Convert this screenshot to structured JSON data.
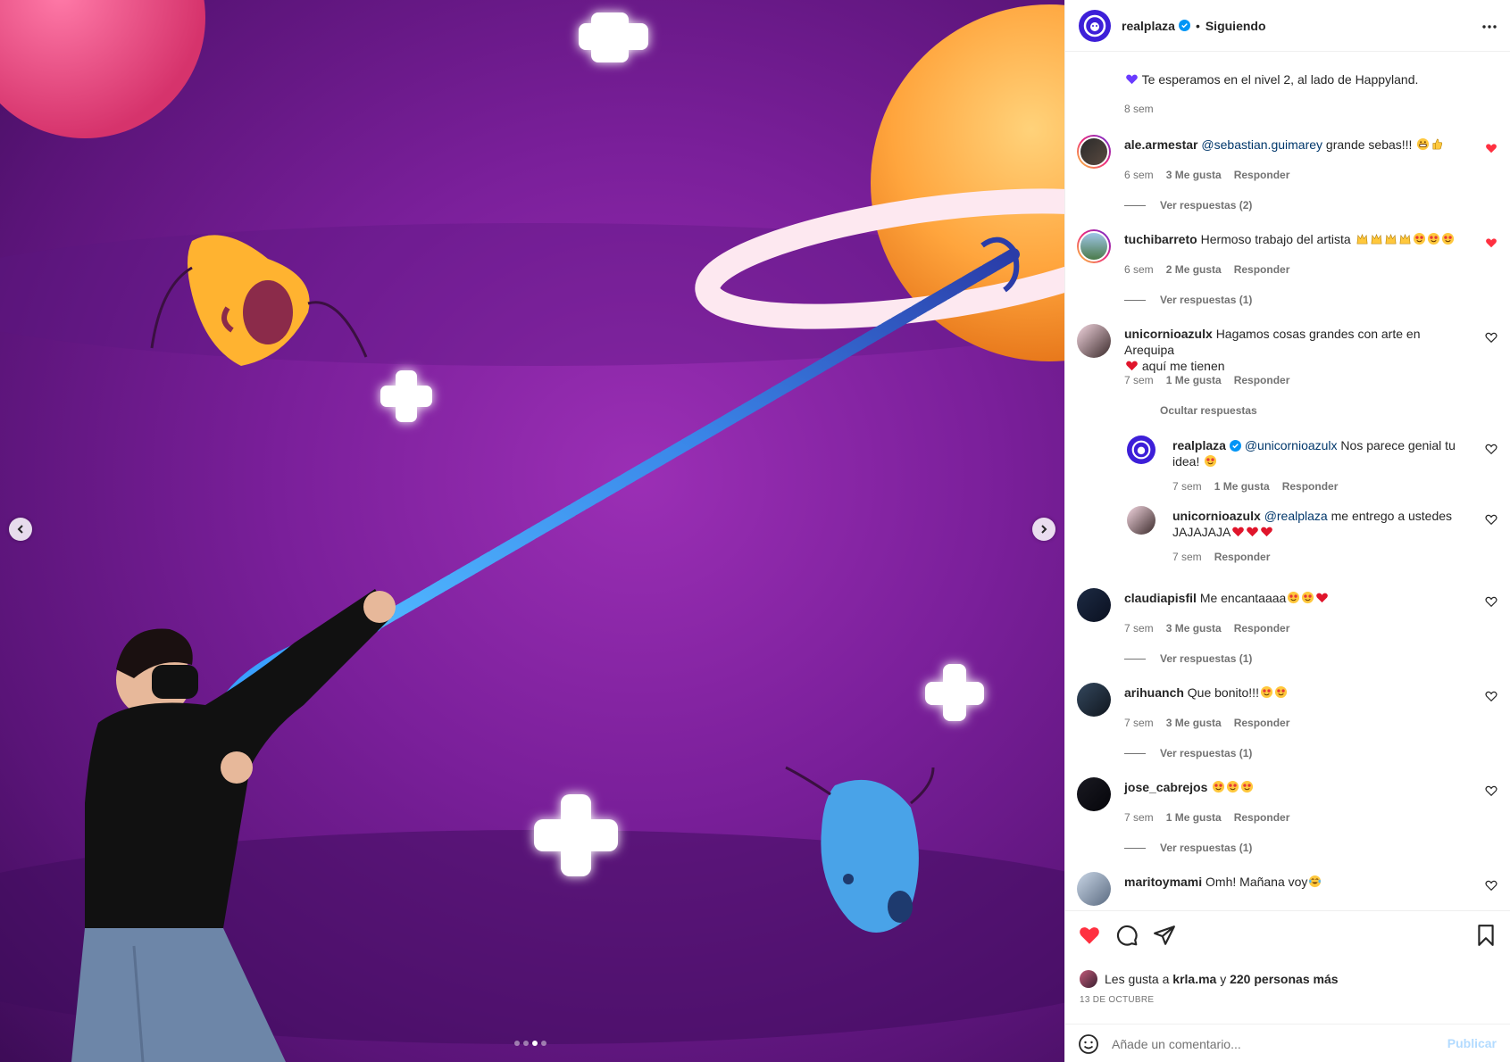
{
  "post": {
    "account": "realplaza",
    "follow_status": "Siguiendo",
    "caption": "Te esperamos en el nivel 2, al lado de Happyland.",
    "caption_time": "8 sem"
  },
  "comments": [
    {
      "user": "ale.armestar",
      "mention": "@sebastian.guimarey",
      "text": " grande sebas!!! ",
      "emojis": [
        "grin",
        "thumbs-up"
      ],
      "time": "6 sem",
      "likes": "3 Me gusta",
      "reply": "Responder",
      "liked": true,
      "replies_label": "Ver respuestas (2)"
    },
    {
      "user": "tuchibarreto",
      "text": "Hermoso trabajo del artista ",
      "emojis": [
        "hands",
        "hands",
        "hands",
        "hands",
        "star-eyes",
        "star-eyes",
        "star-eyes"
      ],
      "time": "6 sem",
      "likes": "2 Me gusta",
      "reply": "Responder",
      "liked": true,
      "replies_label": "Ver respuestas (1)"
    },
    {
      "user": "unicornioazulx",
      "text": "Hagamos cosas grandes con arte en Arequipa",
      "text2": " aquí me tienen",
      "time": "7 sem",
      "likes": "1 Me gusta",
      "reply": "Responder",
      "liked": false,
      "replies_label": "Ocultar respuestas"
    },
    {
      "user": "claudiapisfil",
      "text": "Me encantaaaa",
      "emojis": [
        "star-eyes",
        "star-eyes",
        "red-heart"
      ],
      "time": "7 sem",
      "likes": "3 Me gusta",
      "reply": "Responder",
      "liked": false,
      "replies_label": "Ver respuestas (1)"
    },
    {
      "user": "arihuanch",
      "text": "Que bonito!!!",
      "emojis": [
        "star-eyes",
        "star-eyes"
      ],
      "time": "7 sem",
      "likes": "3 Me gusta",
      "reply": "Responder",
      "liked": false,
      "replies_label": "Ver respuestas (1)"
    },
    {
      "user": "jose_cabrejos",
      "text": "",
      "emojis": [
        "star-eyes",
        "star-eyes",
        "star-eyes"
      ],
      "time": "7 sem",
      "likes": "1 Me gusta",
      "reply": "Responder",
      "liked": false,
      "replies_label": "Ver respuestas (1)"
    },
    {
      "user": "maritoymami",
      "text": "Omh! Mañana voy",
      "emojis": [
        "tears-joy"
      ],
      "time": "",
      "likes": "",
      "reply": "",
      "liked": false,
      "replies_label": ""
    }
  ],
  "replies": [
    {
      "user": "realplaza",
      "mention": "@unicornioazulx",
      "text": " Nos parece genial tu idea! ",
      "emojis": [
        "star-eyes"
      ],
      "time": "7 sem",
      "likes": "1 Me gusta",
      "reply": "Responder"
    },
    {
      "user": "unicornioazulx",
      "mention": "@realplaza",
      "text": " me entrego a ustedes JAJAJAJA",
      "emojis": [
        "red-heart",
        "red-heart",
        "red-heart"
      ],
      "time": "7 sem",
      "reply": "Responder"
    }
  ],
  "footer": {
    "likes_prefix": "Les gusta a ",
    "likes_user": "krla.ma",
    "likes_mid": " y ",
    "likes_count": "220 personas más",
    "date": "13 DE OCTUBRE",
    "comment_placeholder": "Añade un comentario...",
    "publish_label": "Publicar"
  },
  "carousel": {
    "slides": 4,
    "active_index": 2
  },
  "colors": {
    "like_red": "#ff3040",
    "brand": "#3d1fd8",
    "publish_disabled": "#b3dbff",
    "verified": "#0095f6"
  },
  "icons": [
    "more-icon",
    "heart-icon",
    "comment-icon",
    "share-icon",
    "bookmark-icon",
    "emoji-icon",
    "chevron-left-icon",
    "chevron-right-icon",
    "verified-badge-icon"
  ]
}
